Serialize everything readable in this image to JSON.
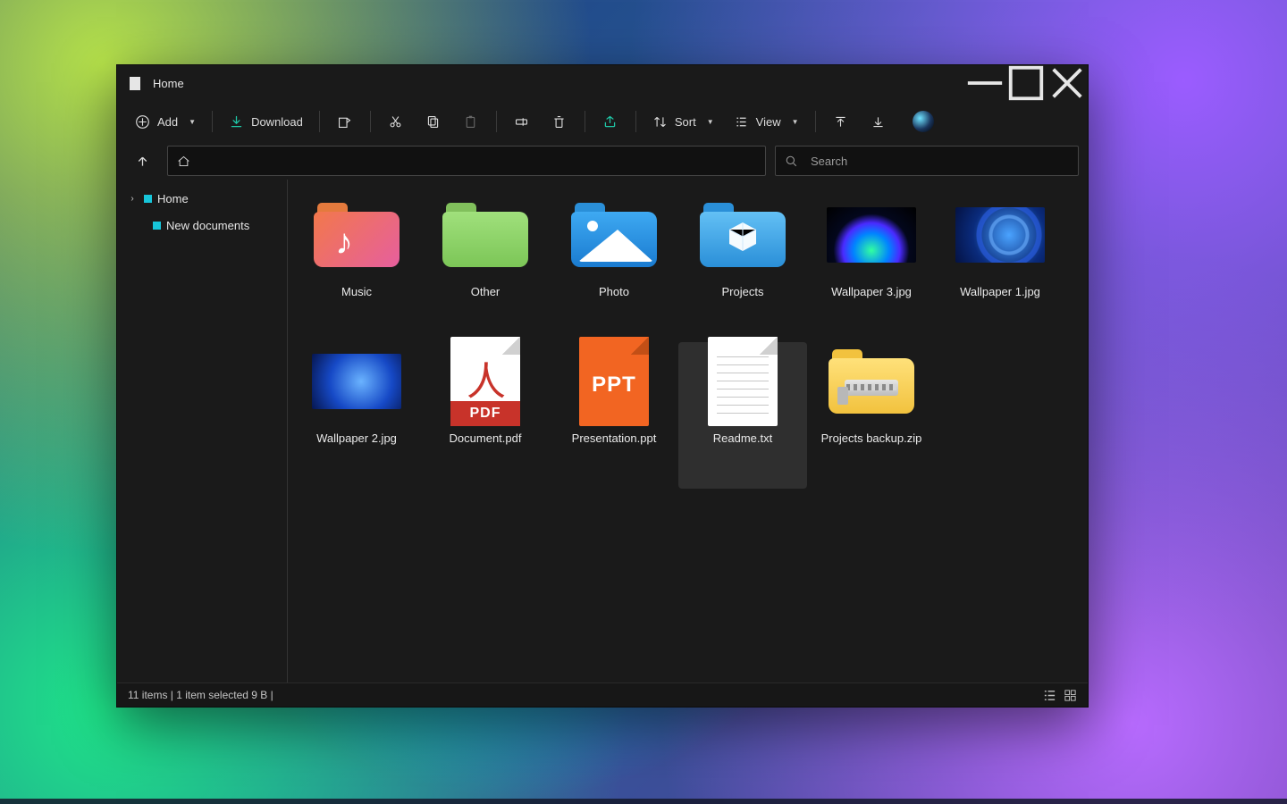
{
  "window": {
    "title": "Home"
  },
  "toolbar": {
    "add": "Add",
    "download": "Download",
    "sort": "Sort",
    "view": "View"
  },
  "search": {
    "placeholder": "Search"
  },
  "sidebar": {
    "items": [
      {
        "label": "Home"
      },
      {
        "label": "New documents"
      }
    ]
  },
  "grid": {
    "items": [
      {
        "label": "Music",
        "type": "folder-music",
        "selected": false
      },
      {
        "label": "Other",
        "type": "folder-green",
        "selected": false
      },
      {
        "label": "Photo",
        "type": "folder-photo",
        "selected": false
      },
      {
        "label": "Projects",
        "type": "folder-proj",
        "selected": false
      },
      {
        "label": "Wallpaper 3.jpg",
        "type": "wall3",
        "selected": false
      },
      {
        "label": "Wallpaper 1.jpg",
        "type": "wall1",
        "selected": false
      },
      {
        "label": "Wallpaper 2.jpg",
        "type": "wall2",
        "selected": false
      },
      {
        "label": "Document.pdf",
        "type": "pdf",
        "selected": false
      },
      {
        "label": "Presentation.ppt",
        "type": "ppt",
        "selected": false
      },
      {
        "label": "Readme.txt",
        "type": "txt",
        "selected": true
      },
      {
        "label": "Projects backup.zip",
        "type": "zip",
        "selected": false
      }
    ]
  },
  "status": {
    "text": "11 items | 1 item selected 9 B |"
  },
  "pdf_band": "PDF",
  "ppt_band": "PPT"
}
